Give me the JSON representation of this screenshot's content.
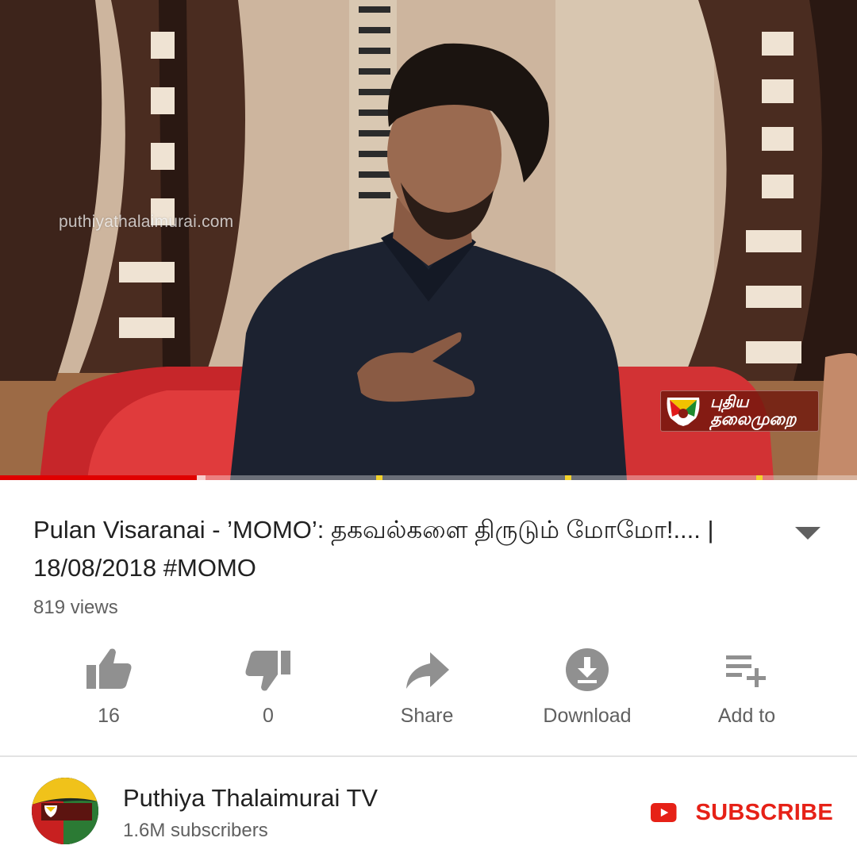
{
  "video": {
    "watermark": "puthiyathalaimurai.com",
    "channel_bug": {
      "line1": "புதிய",
      "line2": "தலைமுறை"
    },
    "progress_fraction": 0.23,
    "buffered_fraction": 0.24
  },
  "title": "Pulan Visaranai - ’MOMO’: தகவல்களை திருடும் மோமோ!.... | 18/08/2018 #MOMO",
  "views": "819 views",
  "actions": [
    {
      "icon": "thumbs-up-icon",
      "label": "16"
    },
    {
      "icon": "thumbs-down-icon",
      "label": "0"
    },
    {
      "icon": "share-icon",
      "label": "Share"
    },
    {
      "icon": "download-icon",
      "label": "Download"
    },
    {
      "icon": "add-to-playlist-icon",
      "label": "Add to"
    }
  ],
  "channel": {
    "name": "Puthiya Thalaimurai TV",
    "subscribers": "1.6M subscribers",
    "avatar_text": {
      "line1": "புதிய",
      "line2": "தலைமுறை"
    }
  },
  "subscribe_label": "SUBSCRIBE",
  "colors": {
    "accent_red": "#e62117",
    "progress_red": "#e00000",
    "icon_grey": "#909090",
    "secondary_text": "#606060"
  }
}
